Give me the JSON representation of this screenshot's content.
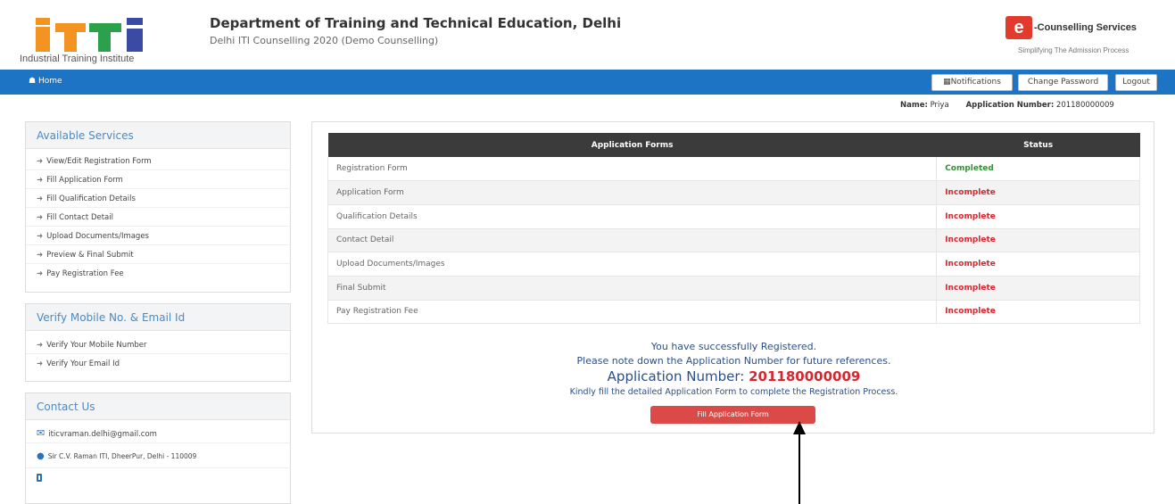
{
  "header": {
    "logo_text": "Industrial Training Institute",
    "title": "Department of Training and Technical Education, Delhi",
    "subtitle": "Delhi ITI Counselling 2020 (Demo Counselling)",
    "brand_badge": "e",
    "brand_name": "-Counselling Services",
    "brand_tagline": "Simplifying The Admission Process"
  },
  "nav": {
    "home": "Home",
    "notifications": "Notifications",
    "change_password": "Change Password",
    "logout": "Logout"
  },
  "user": {
    "name_label": "Name:",
    "name": "Priya",
    "appno_label": "Application Number:",
    "appno": "201180000009"
  },
  "sidebar": {
    "services_title": "Available Services",
    "services": [
      "View/Edit Registration Form",
      "Fill Application Form",
      "Fill Qualification Details",
      "Fill Contact Detail",
      "Upload Documents/Images",
      "Preview & Final Submit",
      "Pay Registration Fee"
    ],
    "verify_title": "Verify Mobile No. & Email Id",
    "verify": [
      "Verify Your Mobile Number",
      "Verify Your Email Id"
    ],
    "contact_title": "Contact Us",
    "email": "iticvraman.delhi@gmail.com",
    "address": "Sir C.V. Raman ITI, DheerPur, Delhi - 110009"
  },
  "table": {
    "headers": [
      "Application Forms",
      "Status"
    ],
    "rows": [
      {
        "form": "Registration Form",
        "status": "Completed"
      },
      {
        "form": "Application Form",
        "status": "Incomplete"
      },
      {
        "form": "Qualification Details",
        "status": "Incomplete"
      },
      {
        "form": "Contact Detail",
        "status": "Incomplete"
      },
      {
        "form": "Upload Documents/Images",
        "status": "Incomplete"
      },
      {
        "form": "Final Submit",
        "status": "Incomplete"
      },
      {
        "form": "Pay Registration Fee",
        "status": "Incomplete"
      }
    ]
  },
  "message": {
    "line1": "You have successfully Registered.",
    "line2": "Please note down the Application Number for future references.",
    "appno_label": "Application Number:",
    "appno": "201180000009",
    "line3": "Kindly fill the detailed Application Form to complete the Registration Process.",
    "button": "Fill Application Form"
  },
  "colors": {
    "navbar": "#1d74c4",
    "completed": "#3a8c3a",
    "incomplete": "#d7262e",
    "button": "#dc4a48"
  }
}
